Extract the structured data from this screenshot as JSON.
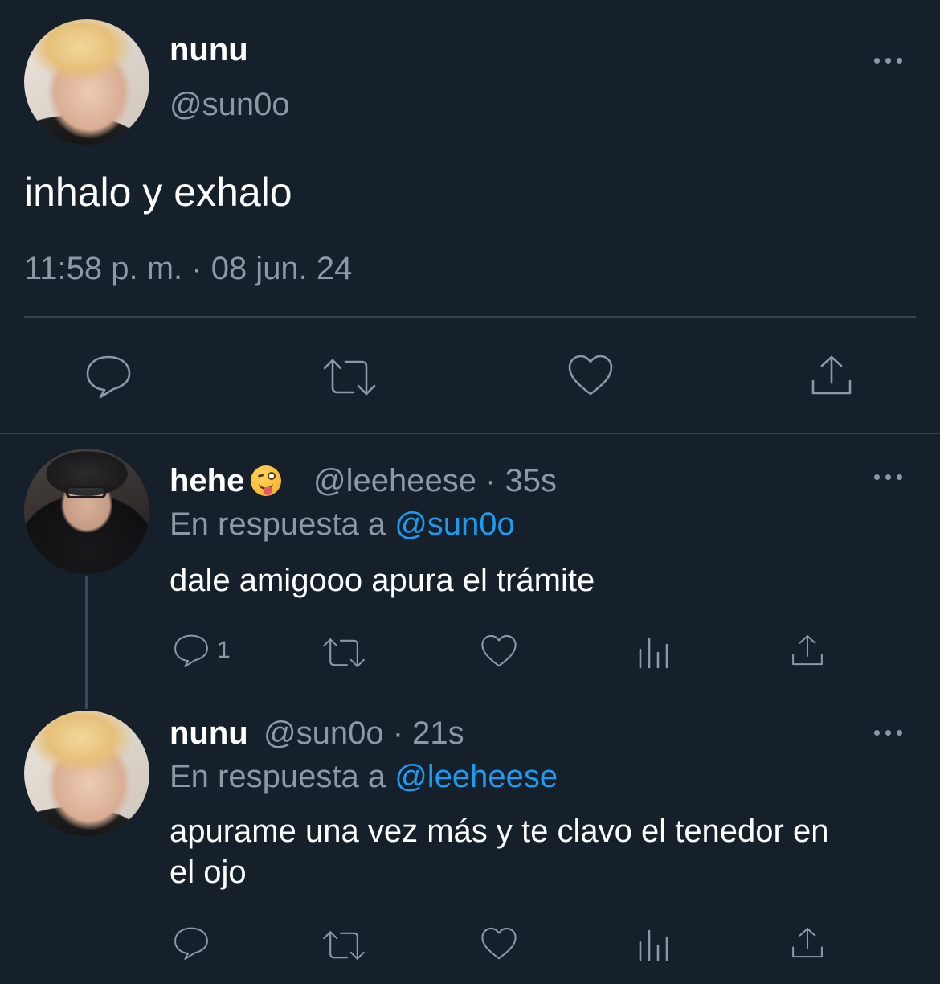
{
  "main_tweet": {
    "name": "nunu",
    "handle": "@sun0o",
    "text": "inhalo y exhalo",
    "timestamp": "11:58 p. m. · 08 jun. 24"
  },
  "replies": [
    {
      "name": "hehe",
      "emoji": "winking-face-with-tongue",
      "handle_time": "@leeheese · 35s",
      "reply_prefix": "En respuesta a",
      "reply_to": "@sun0o",
      "text": "dale amigooo apura el trámite",
      "reply_count": "1"
    },
    {
      "name": "nunu",
      "handle_time": "@sun0o · 21s",
      "reply_prefix": "En respuesta a",
      "reply_to": "@leeheese",
      "text_line1": "apurame una vez más y te clavo el tenedor en",
      "text_line2": "el ojo",
      "reply_count": ""
    }
  ],
  "colors": {
    "background": "#15202b",
    "secondary_text": "#8b98a5",
    "link": "#1d9bf0",
    "divider": "#38444d"
  }
}
